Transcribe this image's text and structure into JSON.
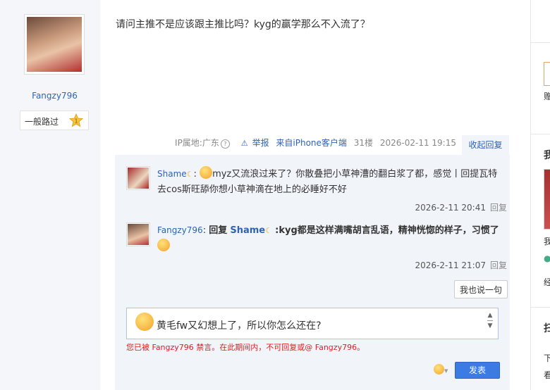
{
  "op": {
    "username": "Fangzy796",
    "level_name": "一般路过",
    "level_num": "1",
    "post_text": "请问主推不是应该跟主推比吗？kyg的赢学那么不入流了？"
  },
  "meta": {
    "ip": "IP属地:广东",
    "help_icon": "?",
    "report": "举报",
    "source": "来自iPhone客户端",
    "floor": "31楼",
    "time": "2026-02-11 19:15",
    "collapse": "收起回复"
  },
  "replies": [
    {
      "user": "Shame",
      "colon": ":",
      "text": "myz又流浪过来了？你散叠把小草神漕的翻白浆了都，感觉丨回提瓦特去cos斯旺舔你想小草神滴在地上的必睡好不好",
      "time": "2026-2-11 20:41",
      "reply": "回复"
    },
    {
      "user": "Fangzy796",
      "colon": ":",
      "reply_word": "回复",
      "target": "Shame",
      "text": ":kyg都是这样满嘴胡言乱语，精神恍惚的样子，习惯了",
      "time": "2026-2-11 21:07",
      "reply": "回复"
    }
  ],
  "say_button": "我也说一句",
  "editor": {
    "text": "黄毛fw又幻想上了，所以你怎么还在?",
    "scroll_up": "▲",
    "scroll_down": "▼"
  },
  "ban_notice": "您已被 Fangzy796 禁言。在此期间内，不可回复或@ Fangzy796。",
  "emoji_arrow": "▼",
  "send_button": "发表",
  "right_sidebar": {
    "t1": "赠",
    "t2": "我",
    "t3": "我",
    "t4": "经",
    "t5": "扫",
    "t6": "下",
    "t7": "看"
  },
  "colors": {
    "link_blue": "#2d64b3",
    "send_blue": "#3c7be4",
    "warning_red": "#e01e1e",
    "reply_bg": "#f1f4f9"
  }
}
